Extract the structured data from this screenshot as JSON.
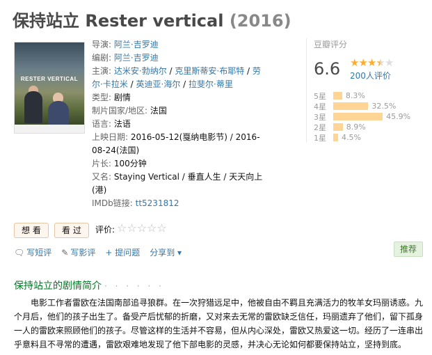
{
  "title": "保持站立 Rester vertical",
  "year": "(2016)",
  "poster": {
    "title": "RESTER VERTICAL"
  },
  "info": {
    "director_label": "导演:",
    "director": "阿兰·吉罗迪",
    "writer_label": "编剧:",
    "writer": "阿兰·吉罗迪",
    "cast_label": "主演:",
    "cast": [
      "达米安·勃纳尔",
      "克里斯蒂安·布耶特",
      "劳尔·卡拉米",
      "英迪亚·海尔",
      "拉斐尔·蒂里"
    ],
    "cast_sep": " / ",
    "genre_label": "类型:",
    "genre": "剧情",
    "country_label": "制片国家/地区:",
    "country": "法国",
    "language_label": "语言:",
    "language": "法语",
    "release_label": "上映日期:",
    "release": "2016-05-12(戛纳电影节) / 2016-08-24(法国)",
    "runtime_label": "片长:",
    "runtime": "100分钟",
    "aka_label": "又名:",
    "aka": "Staying Vertical / 垂直人生 / 天天向上(港)",
    "imdb_label": "IMDb链接:",
    "imdb": "tt5231812"
  },
  "rating": {
    "label": "豆瓣评分",
    "score": "6.6",
    "votes": "200人评价",
    "stars_filled": 3.5,
    "bars": [
      {
        "label": "5星",
        "pct": "8.3%",
        "value": 8.3
      },
      {
        "label": "4星",
        "pct": "32.5%",
        "value": 32.5
      },
      {
        "label": "3星",
        "pct": "45.9%",
        "value": 45.9
      },
      {
        "label": "2星",
        "pct": "8.9%",
        "value": 8.9
      },
      {
        "label": "1星",
        "pct": "4.5%",
        "value": 4.5
      }
    ]
  },
  "actions": {
    "want": "想 看",
    "seen": "看 过",
    "rate_label": "评价:",
    "rate_stars": "☆☆☆☆☆",
    "write_comment": "写短评",
    "write_review": "写影评",
    "ask": "+ 提问题",
    "share": "分享到 ▾",
    "recommend": "推荐"
  },
  "summary": {
    "heading": "保持站立的剧情简介",
    "dots": "· · · · · ·",
    "text": "电影工作者雷欧在法国南部追寻狼群。在一次狩猎远足中，他被自由不羁且充满活力的牧羊女玛丽诱惑。九个月后，他们的孩子出生了。备受产后忧郁的折磨，又对来去无常的雷欧缺乏信任，玛丽遗弃了他们，留下孤身一人的雷欧来照顾他们的孩子。尽管这样的生活并不容易，但从内心深处，雷欧又热爱这一切。经历了一连串出乎意料且不寻常的遭遇，雷欧艰难地发现了他下部电影的灵感，并决心无论如何都要保持站立，坚持到底。"
  },
  "colors": {
    "link": "#3377aa",
    "star": "#ffac2d",
    "bar": "#ffd596",
    "heading_green": "#007722"
  }
}
